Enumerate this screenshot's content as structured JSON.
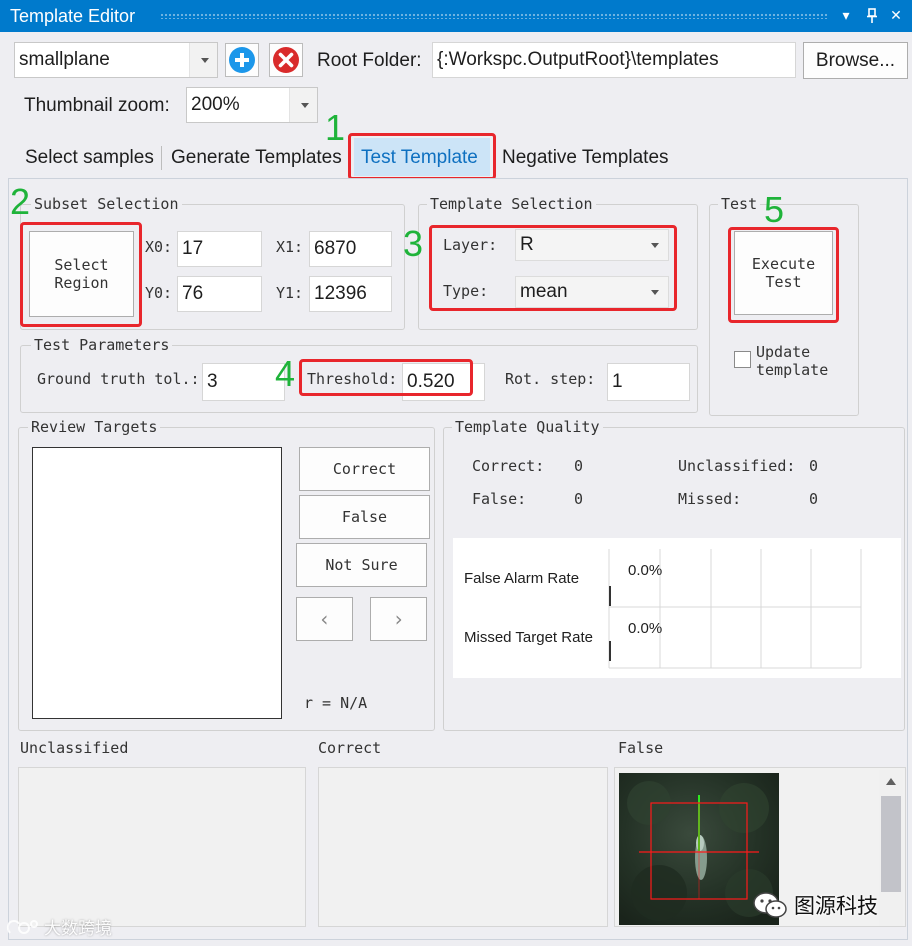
{
  "window": {
    "title": "Template Editor"
  },
  "toolbar": {
    "project_value": "smallplane",
    "root_folder_label": "Root Folder:",
    "root_folder_value": "{:Workspc.OutputRoot}\\templates",
    "browse_label": "Browse...",
    "thumbnail_label": "Thumbnail zoom:",
    "thumbnail_value": "200%"
  },
  "tabs": [
    "Select samples",
    "Generate Templates",
    "Test Template",
    "Negative Templates"
  ],
  "active_tab": "Test Template",
  "step_numbers": [
    "1",
    "2",
    "3",
    "4",
    "5"
  ],
  "subset": {
    "title": "Subset Selection",
    "select_region_label": "Select Region",
    "x0_label": "X0:",
    "x0": "17",
    "y0_label": "Y0:",
    "y0": "76",
    "x1_label": "X1:",
    "x1": "6870",
    "y1_label": "Y1:",
    "y1": "12396"
  },
  "template_selection": {
    "title": "Template Selection",
    "layer_label": "Layer:",
    "layer_value": "R",
    "type_label": "Type:",
    "type_value": "mean"
  },
  "test": {
    "title": "Test",
    "execute_label": "Execute Test",
    "update_label": "Update template",
    "update_checked": false
  },
  "test_parameters": {
    "title": "Test Parameters",
    "gt_tol_label": "Ground truth tol.:",
    "gt_tol_value": "3",
    "threshold_label": "Threshold:",
    "threshold_value": "0.520",
    "rot_step_label": "Rot. step:",
    "rot_step_value": "1"
  },
  "review": {
    "title": "Review Targets",
    "correct_label": "Correct",
    "false_label": "False",
    "not_sure_label": "Not Sure",
    "prev_icon": "‹",
    "next_icon": "›",
    "r_text": "r = N/A"
  },
  "quality": {
    "title": "Template Quality",
    "correct_label": "Correct:",
    "correct_value": "0",
    "false_label": "False:",
    "false_value": "0",
    "unclassified_label": "Unclassified:",
    "unclassified_value": "0",
    "missed_label": "Missed:",
    "missed_value": "0",
    "false_alarm_label": "False Alarm Rate",
    "false_alarm_value": "0.0%",
    "missed_target_label": "Missed Target Rate",
    "missed_target_value": "0.0%"
  },
  "bottom": {
    "unclassified_label": "Unclassified",
    "correct_label": "Correct",
    "false_label": "False"
  },
  "watermarks": {
    "left": "大数跨境",
    "right": "图源科技"
  },
  "colors": {
    "accent": "#007acc",
    "highlight": "#e8262c",
    "step_number": "#1fb33a"
  }
}
